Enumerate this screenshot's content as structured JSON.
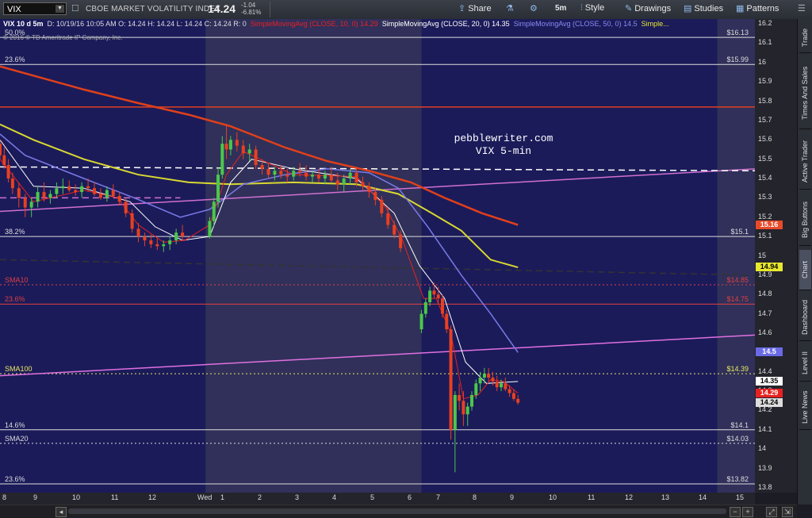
{
  "toolbar": {
    "symbol": "VIX",
    "name": "CBOE MARKET VOLATILITY INDEX",
    "last": "14.24",
    "change": "-1.04",
    "change_pct": "-6.81%",
    "share": "Share",
    "interval": "5m",
    "style": "Style",
    "drawings": "Drawings",
    "studies": "Studies",
    "patterns": "Patterns"
  },
  "legend": {
    "head": "VIX 10 d 5m",
    "ohlc": "D: 10/19/16 10:05 AM   O: 14.24   H: 14.24   L: 14.24   C: 14.24   R: 0",
    "sma10": "SimpleMovingAvg (CLOSE, 10, 0)",
    "sma10_v": "14.29",
    "sma20": "SimpleMovingAvg (CLOSE, 20, 0)",
    "sma20_v": "14.35",
    "sma50": "SimpleMovingAvg (CLOSE, 50, 0)",
    "sma50_v": "14.5",
    "more": "Simple...",
    "copyright": "© 2016 © TD Ameritrade IP Company, Inc."
  },
  "annotation": {
    "line1": "pebblewriter.com",
    "line2": "VIX 5-min"
  },
  "levels": [
    {
      "label": "50.0%",
      "value": "$16.13",
      "y": 16.13,
      "color": "#dddddd",
      "style": "solid"
    },
    {
      "label": "23.6%",
      "value": "$15.99",
      "y": 15.99,
      "color": "#dddddd",
      "style": "solid"
    },
    {
      "label": "38.2%",
      "value": "$15.1",
      "y": 15.1,
      "color": "#dddddd",
      "style": "solid"
    },
    {
      "label": "SMA10",
      "value": "$14.85",
      "y": 14.85,
      "color": "#e04040",
      "style": "dotted"
    },
    {
      "label": "23.6%",
      "value": "$14.75",
      "y": 14.75,
      "color": "#e04040",
      "style": "solid"
    },
    {
      "label": "SMA100",
      "value": "$14.39",
      "y": 14.39,
      "color": "#e8e860",
      "style": "dotted"
    },
    {
      "label": "14.6%",
      "value": "$14.1",
      "y": 14.1,
      "color": "#dddddd",
      "style": "solid"
    },
    {
      "label": "SMA20",
      "value": "$14.03",
      "y": 14.03,
      "color": "#dddddd",
      "style": "dotted"
    },
    {
      "label": "23.6%",
      "value": "$13.82",
      "y": 13.82,
      "color": "#dddddd",
      "style": "solid"
    }
  ],
  "y_axis": {
    "ticks": [
      "16.2",
      "16.1",
      "16",
      "15.9",
      "15.8",
      "15.7",
      "15.6",
      "15.5",
      "15.4",
      "15.3",
      "15.2",
      "15.1",
      "15",
      "14.9",
      "14.8",
      "14.7",
      "14.6",
      "14.5",
      "14.4",
      "14.3",
      "14.2",
      "14.1",
      "14",
      "13.9",
      "13.8"
    ],
    "min": 13.775,
    "max": 16.225
  },
  "price_tags": [
    {
      "value": "15.16",
      "y": 15.16,
      "bg": "#e84a2a",
      "fg": "#ffffff"
    },
    {
      "value": "14.94",
      "y": 14.94,
      "bg": "#e8e830",
      "fg": "#000000"
    },
    {
      "value": "14.5",
      "y": 14.5,
      "bg": "#6a6ae8",
      "fg": "#ffffff"
    },
    {
      "value": "14.35",
      "y": 14.35,
      "bg": "#ffffff",
      "fg": "#000000"
    },
    {
      "value": "14.29",
      "y": 14.29,
      "bg": "#e82020",
      "fg": "#ffffff"
    },
    {
      "value": "14.24",
      "y": 14.24,
      "bg": "#dddddd",
      "fg": "#000000"
    }
  ],
  "x_axis": {
    "labels": [
      "8",
      "9",
      "10",
      "11",
      "12",
      "Wed",
      "1",
      "2",
      "3",
      "4",
      "5",
      "6",
      "7",
      "8",
      "9",
      "10",
      "11",
      "12",
      "13",
      "14",
      "15"
    ]
  },
  "sidebar": [
    "Trade",
    "Times And Sales",
    "Active Trader",
    "Big Buttons",
    "Chart",
    "Dashboard",
    "Level II",
    "Live News"
  ],
  "chart_data": {
    "type": "candlestick",
    "x_range": [
      8,
      26
    ],
    "ylim": [
      13.775,
      16.225
    ],
    "candles": [
      [
        8.0,
        15.58,
        15.6,
        15.5,
        15.52
      ],
      [
        8.1,
        15.52,
        15.56,
        15.45,
        15.47
      ],
      [
        8.2,
        15.47,
        15.5,
        15.38,
        15.4
      ],
      [
        8.3,
        15.4,
        15.43,
        15.32,
        15.35
      ],
      [
        8.45,
        15.35,
        15.38,
        15.25,
        15.3
      ],
      [
        8.6,
        15.3,
        15.32,
        15.2,
        15.25
      ],
      [
        8.75,
        15.25,
        15.3,
        15.2,
        15.28
      ],
      [
        8.9,
        15.28,
        15.36,
        15.25,
        15.33
      ],
      [
        9.05,
        15.33,
        15.38,
        15.28,
        15.3
      ],
      [
        9.2,
        15.3,
        15.34,
        15.27,
        15.32
      ],
      [
        9.35,
        15.32,
        15.38,
        15.3,
        15.35
      ],
      [
        9.5,
        15.35,
        15.4,
        15.32,
        15.36
      ],
      [
        9.65,
        15.36,
        15.39,
        15.33,
        15.34
      ],
      [
        9.8,
        15.34,
        15.37,
        15.31,
        15.33
      ],
      [
        9.95,
        15.33,
        15.38,
        15.3,
        15.36
      ],
      [
        10.1,
        15.36,
        15.4,
        15.33,
        15.35
      ],
      [
        10.25,
        15.35,
        15.38,
        15.31,
        15.32
      ],
      [
        10.4,
        15.32,
        15.35,
        15.29,
        15.3
      ],
      [
        10.55,
        15.3,
        15.36,
        15.28,
        15.34
      ],
      [
        10.7,
        15.34,
        15.37,
        15.3,
        15.31
      ],
      [
        10.85,
        15.31,
        15.33,
        15.26,
        15.28
      ],
      [
        11.0,
        15.28,
        15.3,
        15.2,
        15.22
      ],
      [
        11.15,
        15.22,
        15.24,
        15.12,
        15.14
      ],
      [
        11.3,
        15.14,
        15.17,
        15.07,
        15.1
      ],
      [
        11.45,
        15.1,
        15.12,
        15.05,
        15.08
      ],
      [
        11.6,
        15.08,
        15.11,
        15.04,
        15.06
      ],
      [
        11.75,
        15.06,
        15.09,
        15.03,
        15.05
      ],
      [
        11.9,
        15.05,
        15.08,
        15.02,
        15.06
      ],
      [
        12.05,
        15.06,
        15.1,
        15.03,
        15.08
      ],
      [
        12.2,
        15.08,
        15.14,
        15.06,
        15.12
      ],
      [
        12.35,
        15.12,
        15.16,
        15.08,
        15.1
      ],
      [
        13.0,
        15.1,
        15.2,
        15.09,
        15.18
      ],
      [
        13.1,
        15.18,
        15.3,
        15.15,
        15.28
      ],
      [
        13.2,
        15.28,
        15.46,
        15.25,
        15.42
      ],
      [
        13.3,
        15.42,
        15.62,
        15.4,
        15.58
      ],
      [
        13.4,
        15.58,
        15.68,
        15.5,
        15.55
      ],
      [
        13.5,
        15.55,
        15.62,
        15.52,
        15.6
      ],
      [
        13.65,
        15.6,
        15.64,
        15.54,
        15.57
      ],
      [
        13.8,
        15.57,
        15.6,
        15.5,
        15.53
      ],
      [
        13.95,
        15.53,
        15.58,
        15.49,
        15.55
      ],
      [
        14.1,
        15.55,
        15.57,
        15.45,
        15.47
      ],
      [
        14.25,
        15.47,
        15.5,
        15.42,
        15.45
      ],
      [
        14.4,
        15.45,
        15.48,
        15.4,
        15.42
      ],
      [
        14.55,
        15.42,
        15.46,
        15.39,
        15.44
      ],
      [
        14.7,
        15.44,
        15.47,
        15.4,
        15.42
      ],
      [
        14.85,
        15.42,
        15.45,
        15.38,
        15.41
      ],
      [
        15.0,
        15.41,
        15.46,
        15.39,
        15.44
      ],
      [
        15.15,
        15.44,
        15.48,
        15.41,
        15.43
      ],
      [
        15.3,
        15.43,
        15.47,
        15.39,
        15.41
      ],
      [
        15.45,
        15.41,
        15.44,
        15.38,
        15.42
      ],
      [
        15.6,
        15.42,
        15.45,
        15.38,
        15.4
      ],
      [
        15.75,
        15.4,
        15.44,
        15.37,
        15.42
      ],
      [
        15.9,
        15.42,
        15.46,
        15.38,
        15.39
      ],
      [
        16.05,
        15.39,
        15.43,
        15.34,
        15.37
      ],
      [
        16.2,
        15.37,
        15.42,
        15.33,
        15.4
      ],
      [
        16.35,
        15.4,
        15.45,
        15.37,
        15.43
      ],
      [
        16.5,
        15.43,
        15.46,
        15.36,
        15.38
      ],
      [
        16.65,
        15.38,
        15.41,
        15.34,
        15.36
      ],
      [
        16.8,
        15.36,
        15.38,
        15.3,
        15.33
      ],
      [
        16.95,
        15.33,
        15.35,
        15.26,
        15.29
      ],
      [
        17.1,
        15.29,
        15.31,
        15.2,
        15.22
      ],
      [
        17.25,
        15.22,
        15.25,
        15.14,
        15.16
      ],
      [
        17.4,
        15.16,
        15.18,
        15.09,
        15.11
      ],
      [
        17.55,
        15.11,
        15.13,
        15.02,
        15.04
      ],
      [
        18.05,
        14.62,
        14.72,
        14.6,
        14.7
      ],
      [
        18.15,
        14.7,
        14.78,
        14.68,
        14.76
      ],
      [
        18.25,
        14.76,
        14.84,
        14.74,
        14.82
      ],
      [
        18.35,
        14.82,
        14.86,
        14.78,
        14.8
      ],
      [
        18.45,
        14.8,
        14.84,
        14.75,
        14.78
      ],
      [
        18.55,
        14.78,
        14.8,
        14.68,
        14.7
      ],
      [
        18.65,
        14.7,
        14.72,
        14.6,
        14.62
      ],
      [
        18.75,
        14.62,
        14.64,
        14.05,
        14.1
      ],
      [
        18.85,
        14.1,
        14.3,
        13.88,
        14.28
      ],
      [
        18.95,
        14.28,
        14.34,
        14.2,
        14.25
      ],
      [
        19.05,
        14.25,
        14.3,
        14.12,
        14.18
      ],
      [
        19.15,
        14.18,
        14.24,
        14.12,
        14.22
      ],
      [
        19.25,
        14.22,
        14.3,
        14.2,
        14.28
      ],
      [
        19.35,
        14.28,
        14.36,
        14.26,
        14.34
      ],
      [
        19.45,
        14.34,
        14.4,
        14.3,
        14.37
      ],
      [
        19.55,
        14.37,
        14.42,
        14.34,
        14.39
      ],
      [
        19.65,
        14.39,
        14.42,
        14.35,
        14.37
      ],
      [
        19.75,
        14.37,
        14.4,
        14.33,
        14.35
      ],
      [
        19.85,
        14.35,
        14.38,
        14.3,
        14.32
      ],
      [
        19.95,
        14.32,
        14.36,
        14.3,
        14.34
      ],
      [
        20.05,
        14.34,
        14.37,
        14.3,
        14.31
      ],
      [
        20.15,
        14.31,
        14.33,
        14.27,
        14.29
      ],
      [
        20.25,
        14.29,
        14.31,
        14.25,
        14.26
      ],
      [
        20.35,
        14.26,
        14.28,
        14.23,
        14.24
      ]
    ],
    "sma10": [
      [
        8.0,
        15.5
      ],
      [
        8.8,
        15.28
      ],
      [
        10,
        15.34
      ],
      [
        10.8,
        15.3
      ],
      [
        11.3,
        15.16
      ],
      [
        11.9,
        15.07
      ],
      [
        12.4,
        15.08
      ],
      [
        13.0,
        15.16
      ],
      [
        13.4,
        15.42
      ],
      [
        13.8,
        15.54
      ],
      [
        15.0,
        15.42
      ],
      [
        16.5,
        15.41
      ],
      [
        17.2,
        15.25
      ],
      [
        17.6,
        15.08
      ],
      [
        18.1,
        14.78
      ],
      [
        18.4,
        14.78
      ],
      [
        18.75,
        14.6
      ],
      [
        19.05,
        14.26
      ],
      [
        19.4,
        14.28
      ],
      [
        19.7,
        14.36
      ],
      [
        20.0,
        14.35
      ],
      [
        20.35,
        14.29
      ]
    ],
    "sma20": [
      [
        8.0,
        15.6
      ],
      [
        8.8,
        15.36
      ],
      [
        10,
        15.35
      ],
      [
        11.1,
        15.28
      ],
      [
        11.7,
        15.15
      ],
      [
        12.35,
        15.08
      ],
      [
        13.0,
        15.1
      ],
      [
        13.5,
        15.38
      ],
      [
        14.0,
        15.5
      ],
      [
        15.0,
        15.45
      ],
      [
        16.5,
        15.4
      ],
      [
        17.4,
        15.22
      ],
      [
        18.0,
        14.95
      ],
      [
        18.6,
        14.78
      ],
      [
        19.1,
        14.45
      ],
      [
        19.6,
        14.34
      ],
      [
        20.35,
        14.35
      ]
    ],
    "sma50": [
      [
        8.0,
        15.63
      ],
      [
        8.6,
        15.52
      ],
      [
        10,
        15.4
      ],
      [
        11.2,
        15.3
      ],
      [
        12.3,
        15.2
      ],
      [
        13.0,
        15.24
      ],
      [
        13.8,
        15.37
      ],
      [
        14.8,
        15.42
      ],
      [
        15.8,
        15.45
      ],
      [
        16.8,
        15.43
      ],
      [
        17.5,
        15.35
      ],
      [
        18.2,
        15.15
      ],
      [
        19.0,
        14.9
      ],
      [
        19.7,
        14.7
      ],
      [
        20.35,
        14.5
      ]
    ],
    "sma100": [
      [
        8.0,
        15.68
      ],
      [
        8.8,
        15.6
      ],
      [
        10,
        15.5
      ],
      [
        11.3,
        15.42
      ],
      [
        12.5,
        15.38
      ],
      [
        13.5,
        15.37
      ],
      [
        15.0,
        15.38
      ],
      [
        16.5,
        15.37
      ],
      [
        17.5,
        15.32
      ],
      [
        18.3,
        15.22
      ],
      [
        19.0,
        15.13
      ],
      [
        19.7,
        14.98
      ],
      [
        20.35,
        14.94
      ]
    ],
    "sma200": [
      [
        8.0,
        15.98
      ],
      [
        9.0,
        15.92
      ],
      [
        10,
        15.86
      ],
      [
        11.3,
        15.79
      ],
      [
        12.5,
        15.73
      ],
      [
        13.5,
        15.67
      ],
      [
        14.8,
        15.56
      ],
      [
        15.8,
        15.49
      ],
      [
        16.8,
        15.44
      ],
      [
        17.8,
        15.38
      ],
      [
        18.6,
        15.3
      ],
      [
        19.5,
        15.22
      ],
      [
        20.35,
        15.16
      ]
    ],
    "trend_lines": [
      {
        "from": [
          8,
          15.23
        ],
        "to": [
          26,
          15.45
        ],
        "color": "#d070d0"
      },
      {
        "from": [
          8,
          14.38
        ],
        "to": [
          26,
          14.59
        ],
        "color": "#e070e0"
      },
      {
        "from": [
          8,
          15.77
        ],
        "to": [
          26,
          15.77
        ],
        "color": "#e04020"
      },
      {
        "from": [
          8,
          15.46
        ],
        "to": [
          26,
          15.44
        ],
        "color": "#ffffff",
        "dash": true
      },
      {
        "from": [
          8,
          15.3
        ],
        "to": [
          12.3,
          15.3
        ],
        "color": "#d070d0",
        "dash": true
      },
      {
        "from": [
          8,
          14.98
        ],
        "to": [
          26,
          14.9
        ],
        "color": "#333333",
        "dash": true
      }
    ]
  }
}
